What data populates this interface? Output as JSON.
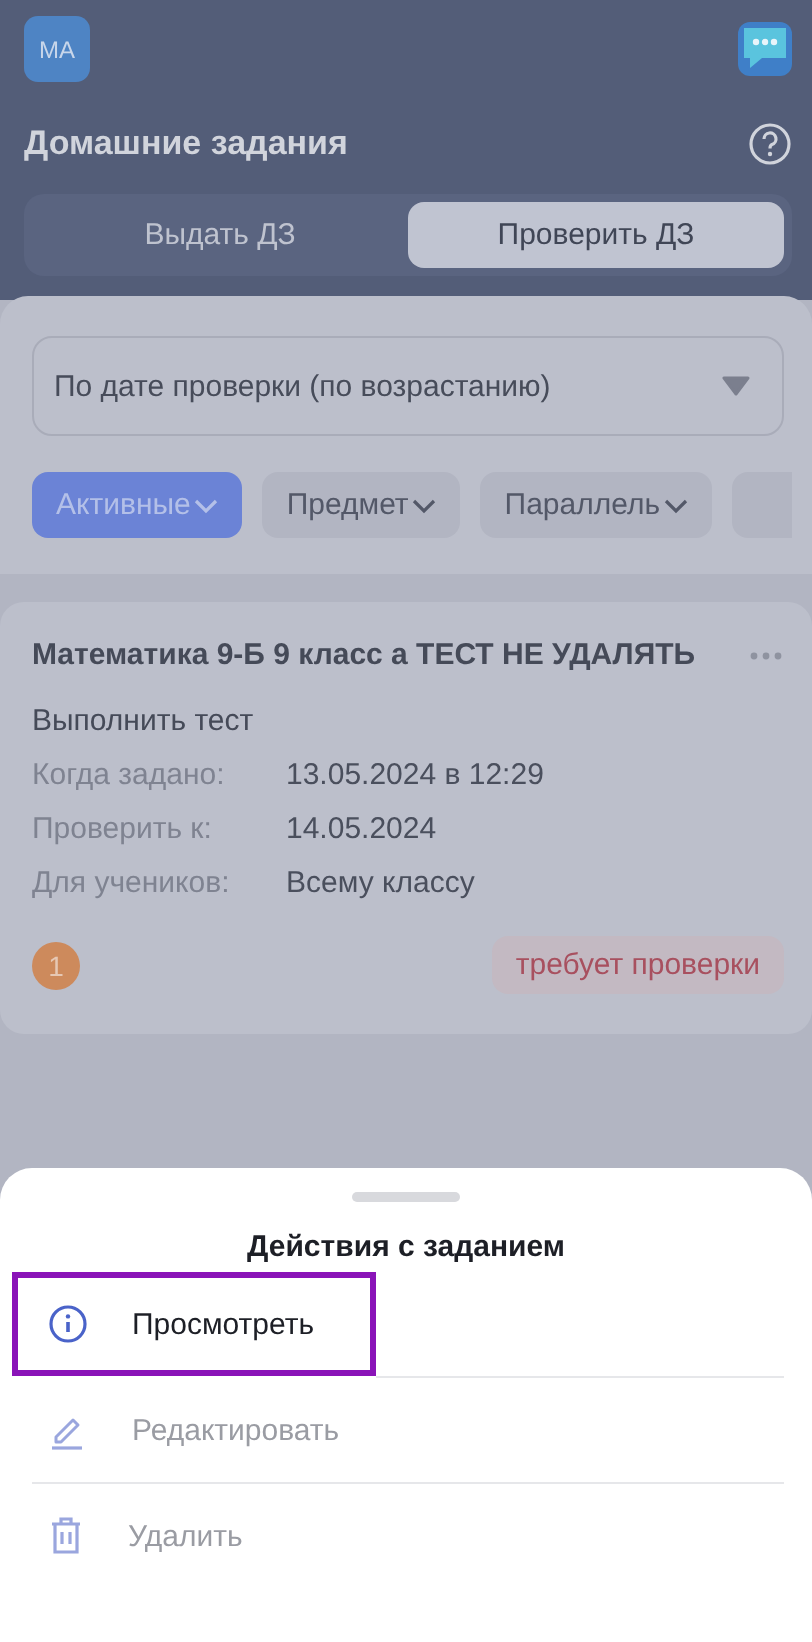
{
  "header": {
    "avatar": "МА",
    "title": "Домашние задания"
  },
  "tabs": [
    {
      "label": "Выдать ДЗ",
      "selected": false
    },
    {
      "label": "Проверить ДЗ",
      "selected": true
    }
  ],
  "sort": {
    "value": "По дате проверки (по возрастанию)"
  },
  "filters": [
    {
      "label": "Активные",
      "selected": true
    },
    {
      "label": "Предмет",
      "selected": false
    },
    {
      "label": "Параллель",
      "selected": false
    }
  ],
  "assignment": {
    "title": "Математика 9-Б 9 класс а ТЕСТ НЕ УДАЛЯТЬ",
    "task": "Выполнить тест",
    "fields": [
      {
        "label": "Когда задано:",
        "value": "13.05.2024 в 12:29"
      },
      {
        "label": "Проверить к:",
        "value": "14.05.2024"
      },
      {
        "label": "Для учеников:",
        "value": "Всему классу"
      }
    ],
    "count": "1",
    "status": "требует проверки"
  },
  "sheet": {
    "title": "Действия с заданием",
    "actions": [
      {
        "kind": "view",
        "label": "Просмотреть",
        "disabled": false,
        "highlighted": true
      },
      {
        "kind": "edit",
        "label": "Редактировать",
        "disabled": true,
        "highlighted": false
      },
      {
        "kind": "delete",
        "label": "Удалить",
        "disabled": true,
        "highlighted": false
      }
    ]
  }
}
